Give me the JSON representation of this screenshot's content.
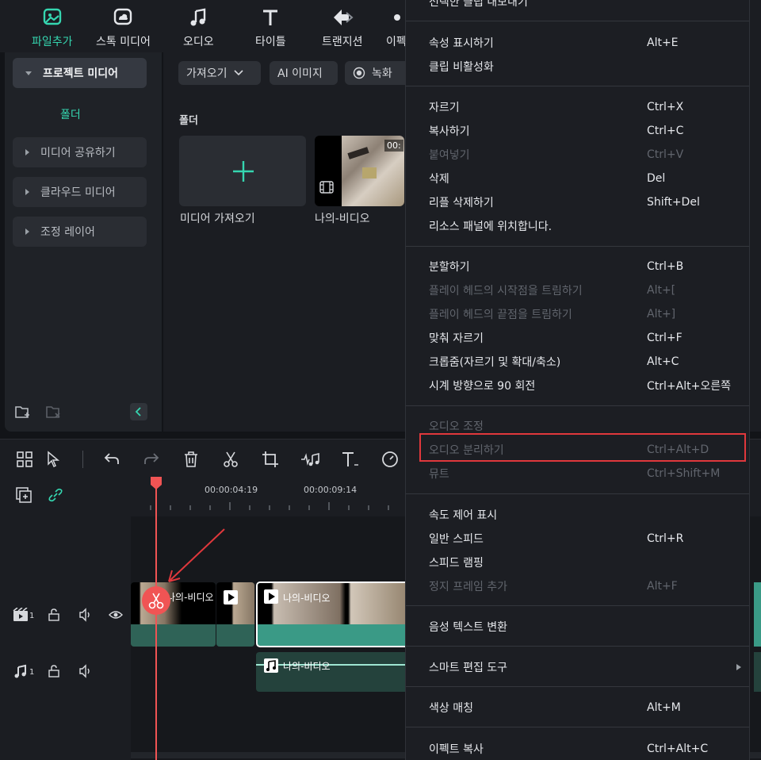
{
  "toolbar": {
    "tabs": [
      {
        "label": "파일추가",
        "icon": "media-icon"
      },
      {
        "label": "스톡 미디어",
        "icon": "cloud-icon"
      },
      {
        "label": "오디오",
        "icon": "music-icon"
      },
      {
        "label": "타이틀",
        "icon": "title-icon"
      },
      {
        "label": "트랜지션",
        "icon": "transition-icon"
      },
      {
        "label": "이펙",
        "icon": "effect-icon"
      }
    ]
  },
  "sidebar": {
    "project_media": "프로젝트 미디어",
    "folder": "폴더",
    "items": [
      {
        "label": "미디어 공유하기"
      },
      {
        "label": "클라우드 미디어"
      },
      {
        "label": "조정 레이어"
      }
    ]
  },
  "media": {
    "import_dropdown": "가져오기",
    "ai_image": "AI 이미지",
    "record": "녹화",
    "folder_title": "폴더",
    "import_card_label": "미디어 가져오기",
    "video_card_label": "나의-비디오",
    "video_duration": "00:"
  },
  "timeline": {
    "ruler": [
      "00:00:04:19",
      "00:00:09:14"
    ],
    "video_track_num": "1",
    "audio_track_num": "1",
    "clip1_label": "나의-비디오",
    "clip2_label": "나의-비디오",
    "audio_clip_label": "나의-비디오"
  },
  "context_menu": {
    "items": [
      {
        "label": "선택한 클립 내보내기",
        "shortcut": "",
        "disabled": false
      },
      {
        "label": "속성 표시하기",
        "shortcut": "Alt+E",
        "disabled": false
      },
      {
        "label": "클립 비활성화",
        "shortcut": "",
        "disabled": false
      },
      {
        "label": "자르기",
        "shortcut": "Ctrl+X",
        "disabled": false
      },
      {
        "label": "복사하기",
        "shortcut": "Ctrl+C",
        "disabled": false
      },
      {
        "label": "붙여넣기",
        "shortcut": "Ctrl+V",
        "disabled": true
      },
      {
        "label": "삭제",
        "shortcut": "Del",
        "disabled": false
      },
      {
        "label": "리플 삭제하기",
        "shortcut": "Shift+Del",
        "disabled": false
      },
      {
        "label": "리소스 패널에 위치합니다.",
        "shortcut": "",
        "disabled": false
      },
      {
        "label": "분할하기",
        "shortcut": "Ctrl+B",
        "disabled": false
      },
      {
        "label": "플레이 헤드의 시작점을 트림하기",
        "shortcut": "Alt+[",
        "disabled": true
      },
      {
        "label": "플레이 헤드의 끝점을 트림하기",
        "shortcut": "Alt+]",
        "disabled": true
      },
      {
        "label": "맞춰 자르기",
        "shortcut": "Ctrl+F",
        "disabled": false
      },
      {
        "label": "크롭줌(자르기 및 확대/축소)",
        "shortcut": "Alt+C",
        "disabled": false
      },
      {
        "label": "시계 방향으로 90 회전",
        "shortcut": "Ctrl+Alt+오른쪽",
        "disabled": false
      },
      {
        "label": "오디오 조정",
        "shortcut": "",
        "disabled": true
      },
      {
        "label": "오디오 분리하기",
        "shortcut": "Ctrl+Alt+D",
        "disabled": true
      },
      {
        "label": "뮤트",
        "shortcut": "Ctrl+Shift+M",
        "disabled": true
      },
      {
        "label": "속도 제어 표시",
        "shortcut": "",
        "disabled": false
      },
      {
        "label": "일반 스피드",
        "shortcut": "Ctrl+R",
        "disabled": false
      },
      {
        "label": "스피드 램핑",
        "shortcut": "",
        "disabled": false
      },
      {
        "label": "정지 프레임 추가",
        "shortcut": "Alt+F",
        "disabled": true
      },
      {
        "label": "음성 텍스트 변환",
        "shortcut": "",
        "disabled": false
      },
      {
        "label": "스마트 편집 도구",
        "shortcut": "",
        "disabled": false
      },
      {
        "label": "색상 매칭",
        "shortcut": "Alt+M",
        "disabled": false
      },
      {
        "label": "이펙트 복사",
        "shortcut": "Ctrl+Alt+C",
        "disabled": false
      }
    ]
  },
  "colors": {
    "accent": "#35d6b0",
    "playhead": "#f05454",
    "highlight_box": "#e0383c",
    "clip_green": "#3a9a86"
  }
}
